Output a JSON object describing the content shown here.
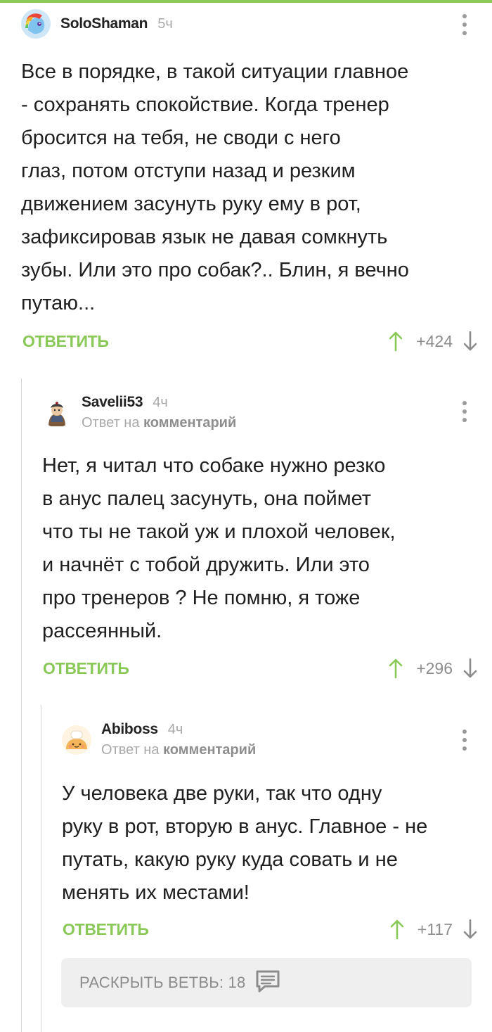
{
  "comments": [
    {
      "author": "SoloShaman",
      "time": "5ч",
      "body": "Все в порядке, в такой ситуации главное\n- сохранять спокойствие. Когда тренер\nбросится на тебя,  не своди с него\nглаз, потом отступи назад и резким\nдвижением засунуть руку ему в рот,\nзафиксировав язык не давая сомкнуть\nзубы. Или это про собак?.. Блин, я вечно\nпутаю...",
      "reply_label": "ОТВЕТИТЬ",
      "rating": "+424",
      "avatar_icon": "rainbow-pony-avatar"
    },
    {
      "author": "Savelii53",
      "time": "4ч",
      "reply_prefix": "Ответ на",
      "reply_target": "комментарий",
      "body": "Нет, я читал что собаке нужно резко\nв анус палец засунуть, она поймет\nчто ты не такой уж и плохой человек,\nи начнёт с тобой дружить. Или это\nпро тренеров ? Не помню, я тоже\nрассеянный.",
      "reply_label": "ОТВЕТИТЬ",
      "rating": "+296",
      "avatar_icon": "character-avatar"
    },
    {
      "author": "Abiboss",
      "time": "4ч",
      "reply_prefix": "Ответ на",
      "reply_target": "комментарий",
      "body": "У человека две руки, так что одну\nруку в рот, вторую в анус. Главное - не\nпутать, какую руку куда совать и не\nменять их местами!",
      "reply_label": "ОТВЕТИТЬ",
      "rating": "+117",
      "avatar_icon": "bun-avatar"
    }
  ],
  "expand_branch": {
    "label": "РАСКРЫТЬ ВЕТВЬ: 18",
    "icon": "comment-bubble-icon"
  },
  "colors": {
    "accent": "#8ac858",
    "muted": "#a9a9a9",
    "panel": "#efefef"
  }
}
